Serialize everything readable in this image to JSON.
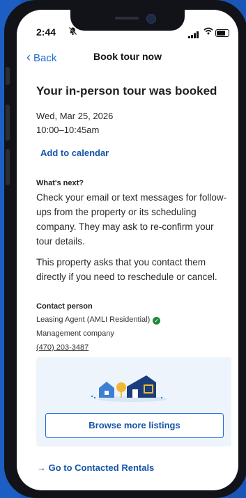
{
  "status_bar": {
    "time": "2:44"
  },
  "nav": {
    "back_label": "Back",
    "title": "Book tour now"
  },
  "confirmation": {
    "heading": "Your in-person tour was booked",
    "date": "Wed, Mar 25, 2026",
    "time": "10:00–10:45am",
    "add_to_calendar": "Add to calendar"
  },
  "next": {
    "title": "What's next?",
    "paragraph1": "Check your email or text messages for follow-ups from the property or its scheduling company. They may ask to re-confirm your tour details.",
    "paragraph2": "This property asks that you contact them directly if you need to reschedule or cancel."
  },
  "contact": {
    "title": "Contact person",
    "name": "Leasing Agent (AMLI Residential)",
    "role": "Management company",
    "phone": "(470) 203-3487"
  },
  "promo": {
    "button_label": "Browse more listings"
  },
  "footer": {
    "link_label": "→ Go to Contacted Rentals"
  },
  "colors": {
    "accent": "#1b6ad6",
    "link": "#1454a8",
    "verified": "#1f8a3a",
    "card_bg": "#eef4fb"
  }
}
